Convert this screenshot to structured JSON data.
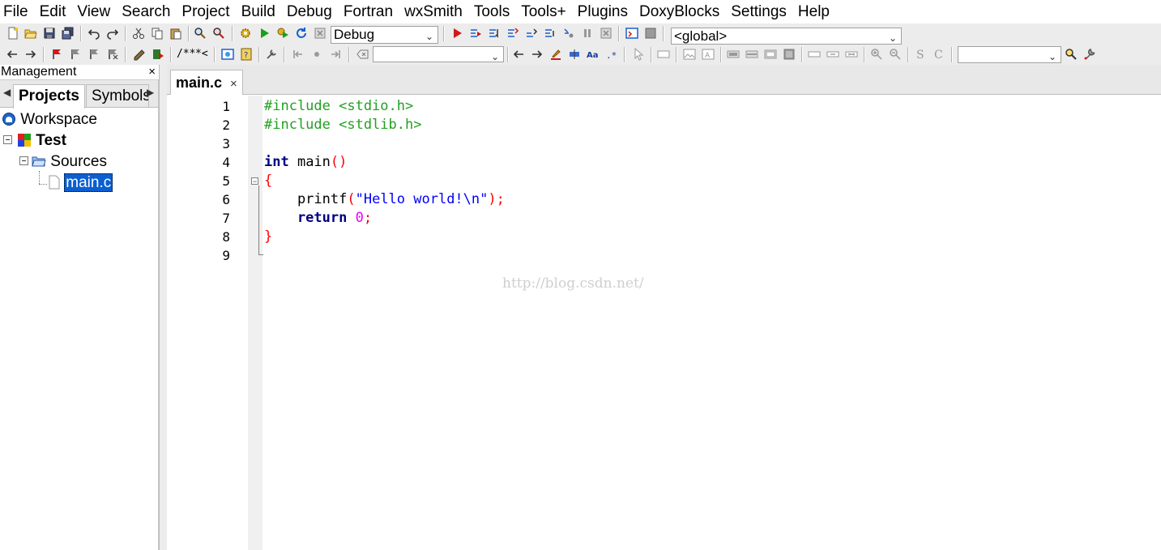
{
  "menu": [
    "File",
    "Edit",
    "View",
    "Search",
    "Project",
    "Build",
    "Debug",
    "Fortran",
    "wxSmith",
    "Tools",
    "Tools+",
    "Plugins",
    "DoxyBlocks",
    "Settings",
    "Help"
  ],
  "toolbar": {
    "build_target": "Debug",
    "scope": "<global>",
    "doxy_comment_block": "/**",
    "doxy_line_comment": "*<"
  },
  "management": {
    "title": "Management",
    "close_glyph": "×",
    "tabs": [
      "Projects",
      "Symbols"
    ],
    "tree": {
      "workspace": "Workspace",
      "project": "Test",
      "folder": "Sources",
      "file": "main.c"
    }
  },
  "editor": {
    "tab_label": "main.c",
    "tab_close": "×",
    "line_numbers": [
      "1",
      "2",
      "3",
      "4",
      "5",
      "6",
      "7",
      "8",
      "9"
    ],
    "code": {
      "l1": "#include <stdio.h>",
      "l2": "#include <stdlib.h>",
      "l4_kw": "int",
      "l4_name": " main",
      "l4_parens": "()",
      "l5": "{",
      "l6_fn": "    printf",
      "l6_open": "(",
      "l6_str": "\"Hello world!\\n\"",
      "l6_close": ");",
      "l7_kw": "    return",
      "l7_num": " 0",
      "l7_semi": ";",
      "l8": "}"
    },
    "watermark": "http://blog.csdn.net/"
  },
  "colors": {
    "preprocessor": "#22a022",
    "keyword": "#000080",
    "brace": "#ff0000",
    "string": "#0000ff",
    "number": "#f000f0",
    "selection": "#0b5fd1"
  }
}
